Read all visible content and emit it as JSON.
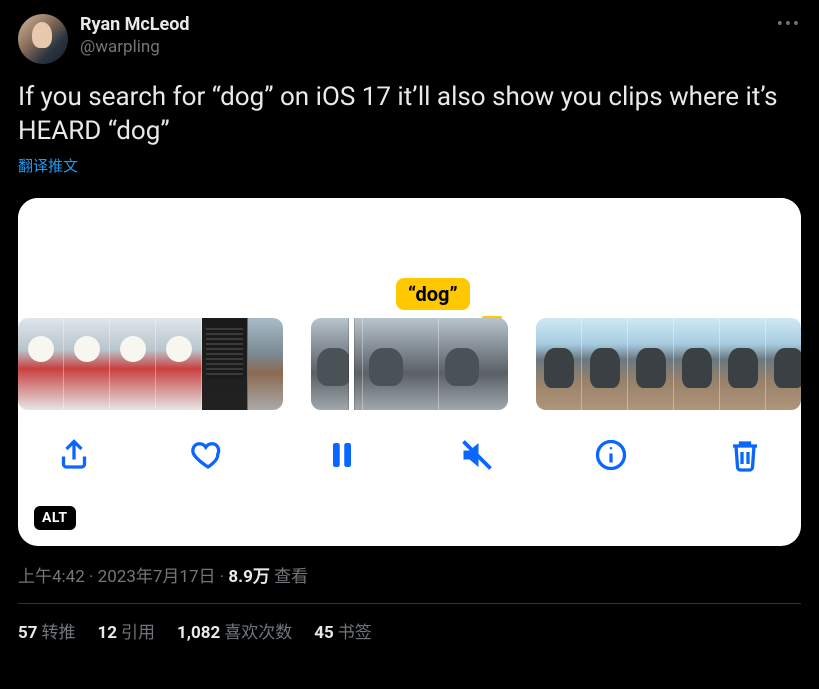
{
  "author": {
    "display_name": "Ryan McLeod",
    "handle": "@warpling"
  },
  "tweet_text": "If you search for “dog” on iOS 17 it’ll also show you clips where it’s HEARD “dog”",
  "translate_label": "翻译推文",
  "media": {
    "highlight_tag": "“dog”",
    "alt_badge": "ALT",
    "toolbar_icons": [
      "share",
      "heart",
      "pause",
      "mute",
      "info",
      "trash"
    ]
  },
  "meta": {
    "time": "上午4:42",
    "date": "2023年7月17日",
    "views_number": "8.9万",
    "views_label": "查看",
    "separator": " · "
  },
  "stats": {
    "retweets": {
      "count": "57",
      "label": "转推"
    },
    "quotes": {
      "count": "12",
      "label": "引用"
    },
    "likes": {
      "count": "1,082",
      "label": "喜欢次数"
    },
    "bookmarks": {
      "count": "45",
      "label": "书签"
    }
  }
}
